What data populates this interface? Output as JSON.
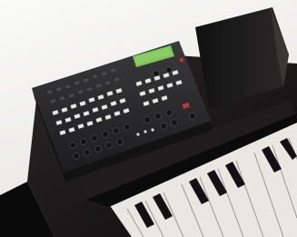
{
  "scene": {
    "subject": "sequencer-on-piano",
    "colors": {
      "background": "#f0efed",
      "piano_body": "#1a1718",
      "sequencer_body": "#2a2a2c",
      "lcd": "#7fc15a",
      "accent_red": "#c8343a",
      "white_key": "#f4f3ef",
      "black_key": "#141214"
    }
  }
}
